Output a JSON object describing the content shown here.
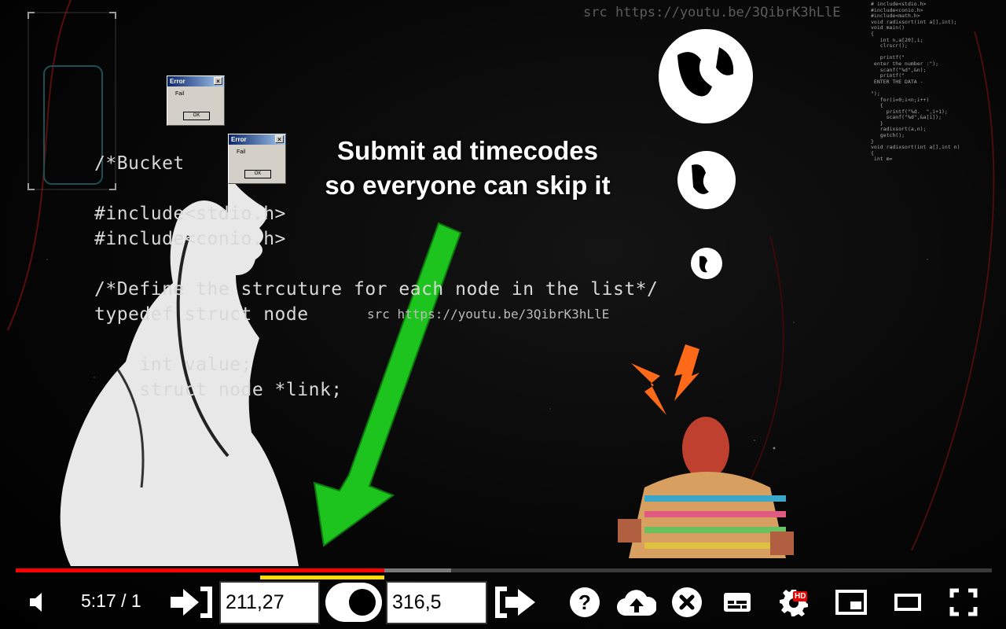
{
  "video": {
    "overlay_line1": "Submit ad timecodes",
    "overlay_line2": "so everyone can skip it",
    "watermark_top": "src https://youtu.be/3QibrK3hLlE",
    "watermark_mid": "src https://youtu.be/3QibrK3hLlE",
    "code_lines": [
      "/*Bucket",
      "#include<stdio.h>",
      "#include<conio.h>",
      "/*Define the strcuture for each node in the list*/",
      "typedef struct node",
      "    int value;",
      "    struct node *link;"
    ],
    "mini_code": "# include<stdio.h>\n#include<conio.h>\n#include<math.h>\nvoid radixsort(int a[],int);\nvoid main()\n{\n   int n,a[20],i;\n   clrscr();\n\n   printf(\"\n enter the number :\");\n   scanf(\"%d\",&n);\n   printf(\"\n ENTER THE DATA -\n\n\");\n   for(i=0;i<n;i++)\n   {\n     printf(\"%d.  \",i+1);\n     scanf(\"%d\",&a[i]);\n   }\n   radixsort(a,n);\n   getch();\n}\nvoid radixsort(int a[],int n)\n{\n int m=",
    "error_dialog": {
      "title": "Error",
      "message": "Fail",
      "ok_label": "OK"
    }
  },
  "player": {
    "progress": {
      "played_fraction": 0.378,
      "buffered_fraction": 0.446
    },
    "segment": {
      "start_fraction": 0.25,
      "end_fraction": 0.378,
      "color": "#ffdd00"
    },
    "time_display": "5:17 / 1",
    "segment_start_value": "211,27",
    "segment_end_value": "316,5",
    "hd_badge": "HD",
    "accent_color": "#ff0000",
    "icons": {
      "volume": "volume-icon",
      "set_start": "set-start-time-icon",
      "toggle": "segment-toggle",
      "set_end": "set-end-time-icon",
      "help": "help-icon",
      "upload": "upload-cloud-icon",
      "cancel": "cancel-icon",
      "subtitles": "subtitles-icon",
      "settings": "settings-gear-icon",
      "miniplayer": "miniplayer-icon",
      "theater": "theater-mode-icon",
      "fullscreen": "fullscreen-icon"
    }
  }
}
